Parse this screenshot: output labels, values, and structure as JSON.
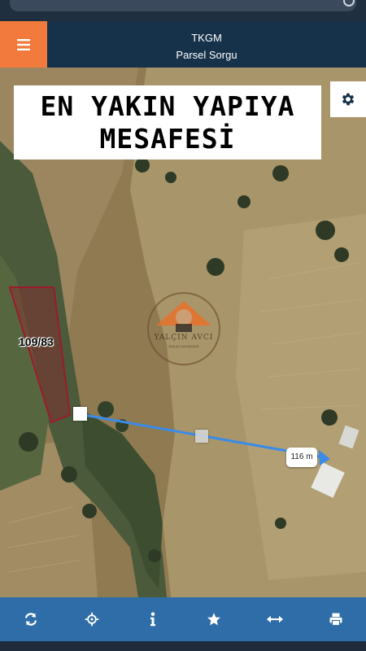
{
  "header": {
    "title": "TKGM",
    "subtitle": "Parsel Sorgu"
  },
  "banner": {
    "line1": "EN YAKIN YAPIYA",
    "line2": "MESAFESİ"
  },
  "map": {
    "parcel_label": "109/83",
    "distance_label": "116 m",
    "watermark_name": "YALÇIN AVCI",
    "watermark_tagline": "EMLAK DANIŞMANI"
  },
  "colors": {
    "header": "#16324a",
    "menu": "#f17a3c",
    "toolbar": "#2f6da8",
    "parcel": "#9b1b2b",
    "measure": "#3b8be8"
  },
  "toolbar": {
    "items": [
      {
        "icon": "refresh-icon"
      },
      {
        "icon": "locate-icon"
      },
      {
        "icon": "info-icon"
      },
      {
        "icon": "star-icon"
      },
      {
        "icon": "measure-icon"
      },
      {
        "icon": "print-icon"
      }
    ]
  }
}
